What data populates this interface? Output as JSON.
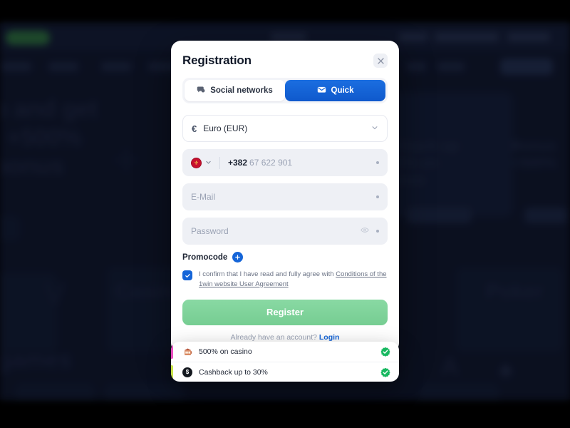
{
  "background": {
    "top_pill": "",
    "nav_items": [
      "",
      "",
      "",
      ""
    ],
    "hero_line1": "p and get",
    "hero_line2": "t +500%",
    "hero_line3": "bonus",
    "card_right_1_line1": "shback up",
    "card_right_1_line2": "30% on",
    "card_right_1_line3": "sinos",
    "card_right_2_line1": "Bonus",
    "card_right_2_line2": "+500%",
    "word_casino": "Casino",
    "word_poker": "Poker",
    "word_games": "games"
  },
  "modal": {
    "title": "Registration",
    "close_label": "×",
    "tabs": [
      {
        "label": "Social networks",
        "icon": "chat-bubble-icon",
        "active": false
      },
      {
        "label": "Quick",
        "icon": "envelope-icon",
        "active": true
      }
    ],
    "currency": {
      "symbol": "€",
      "value": "Euro (EUR)",
      "chevron": "chevron-down-icon"
    },
    "phone": {
      "flag": "montenegro-flag-icon",
      "dial_code": "+382",
      "number_placeholder": "67 622 901",
      "required_mark": "•"
    },
    "email": {
      "placeholder": "E-Mail",
      "required_mark": "•"
    },
    "password": {
      "placeholder": "Password",
      "toggle_icon": "eye-icon",
      "required_mark": "•"
    },
    "promocode": {
      "label": "Promocode",
      "add_icon": "plus-circle-icon"
    },
    "agreement": {
      "checked": true,
      "text": "I confirm that I have read and fully agree with ",
      "link_text": "Conditions of the 1win website User Agreement"
    },
    "submit_label": "Register",
    "footer_text": "Already have an account? ",
    "footer_link": "Login",
    "colors": {
      "accent_blue": "#1565d8",
      "register_green": "#7fd39b",
      "field_bg": "#eef0f5"
    }
  },
  "bonuses": [
    {
      "label": "500% on casino",
      "icon": "slot-machine-icon",
      "bar_color": "#e94ec0",
      "check_icon": "verified-check-icon"
    },
    {
      "label": "Cashback up to 30%",
      "icon": "money-coin-icon",
      "bar_color": "#c8e24a",
      "check_icon": "verified-check-icon"
    }
  ]
}
